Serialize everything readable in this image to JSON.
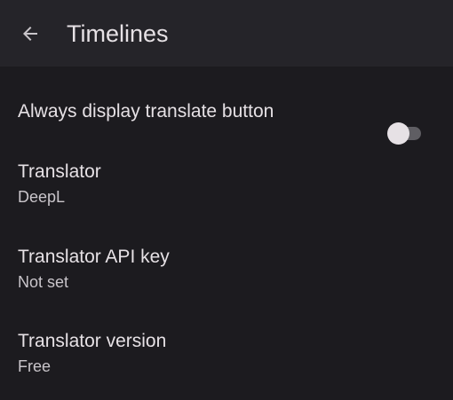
{
  "app_bar": {
    "back_icon": "arrow-back-icon",
    "title": "Timelines"
  },
  "settings": [
    {
      "title": "Always display translate button",
      "summary": "",
      "toggle": false
    },
    {
      "title": "Translator",
      "summary": "DeepL"
    },
    {
      "title": "Translator API key",
      "summary": "Not set"
    },
    {
      "title": "Translator version",
      "summary": "Free"
    }
  ],
  "colors": {
    "background": "#1c1b1f",
    "app_bar": "#252429",
    "text_primary": "#e6e1e5",
    "text_secondary": "#c9c5ca",
    "switch_track_off": "#5f5e63"
  }
}
